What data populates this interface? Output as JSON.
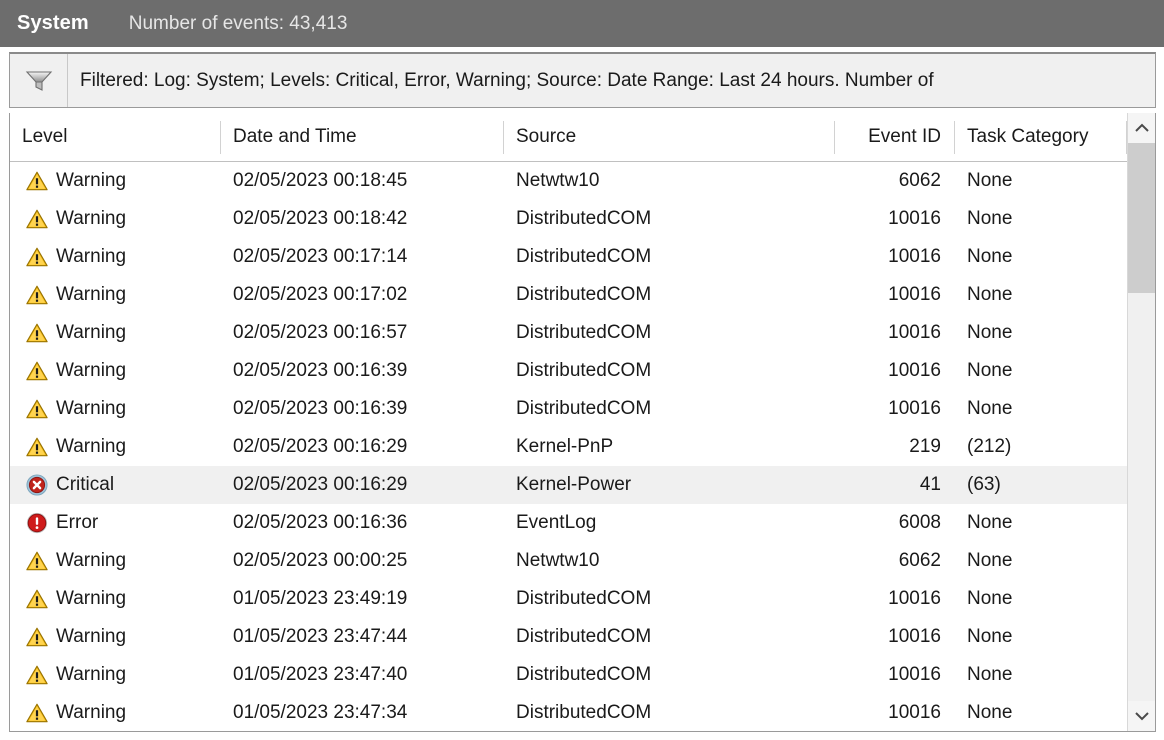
{
  "header": {
    "log_name": "System",
    "event_count_label": "Number of events: 43,413"
  },
  "filter": {
    "icon": "funnel-filter-icon",
    "text": "Filtered: Log: System; Levels: Critical, Error, Warning; Source: Date Range: Last 24 hours. Number of"
  },
  "columns": [
    {
      "key": "level",
      "label": "Level"
    },
    {
      "key": "date",
      "label": "Date and Time"
    },
    {
      "key": "source",
      "label": "Source"
    },
    {
      "key": "eventid",
      "label": "Event ID"
    },
    {
      "key": "task",
      "label": "Task Category"
    }
  ],
  "rows": [
    {
      "level": "Warning",
      "icon": "warning-icon",
      "date": "02/05/2023 00:18:45",
      "source": "Netwtw10",
      "eventid": "6062",
      "task": "None",
      "selected": false
    },
    {
      "level": "Warning",
      "icon": "warning-icon",
      "date": "02/05/2023 00:18:42",
      "source": "DistributedCOM",
      "eventid": "10016",
      "task": "None",
      "selected": false
    },
    {
      "level": "Warning",
      "icon": "warning-icon",
      "date": "02/05/2023 00:17:14",
      "source": "DistributedCOM",
      "eventid": "10016",
      "task": "None",
      "selected": false
    },
    {
      "level": "Warning",
      "icon": "warning-icon",
      "date": "02/05/2023 00:17:02",
      "source": "DistributedCOM",
      "eventid": "10016",
      "task": "None",
      "selected": false
    },
    {
      "level": "Warning",
      "icon": "warning-icon",
      "date": "02/05/2023 00:16:57",
      "source": "DistributedCOM",
      "eventid": "10016",
      "task": "None",
      "selected": false
    },
    {
      "level": "Warning",
      "icon": "warning-icon",
      "date": "02/05/2023 00:16:39",
      "source": "DistributedCOM",
      "eventid": "10016",
      "task": "None",
      "selected": false
    },
    {
      "level": "Warning",
      "icon": "warning-icon",
      "date": "02/05/2023 00:16:39",
      "source": "DistributedCOM",
      "eventid": "10016",
      "task": "None",
      "selected": false
    },
    {
      "level": "Warning",
      "icon": "warning-icon",
      "date": "02/05/2023 00:16:29",
      "source": "Kernel-PnP",
      "eventid": "219",
      "task": "(212)",
      "selected": false
    },
    {
      "level": "Critical",
      "icon": "critical-icon",
      "date": "02/05/2023 00:16:29",
      "source": "Kernel-Power",
      "eventid": "41",
      "task": "(63)",
      "selected": true
    },
    {
      "level": "Error",
      "icon": "error-icon",
      "date": "02/05/2023 00:16:36",
      "source": "EventLog",
      "eventid": "6008",
      "task": "None",
      "selected": false
    },
    {
      "level": "Warning",
      "icon": "warning-icon",
      "date": "02/05/2023 00:00:25",
      "source": "Netwtw10",
      "eventid": "6062",
      "task": "None",
      "selected": false
    },
    {
      "level": "Warning",
      "icon": "warning-icon",
      "date": "01/05/2023 23:49:19",
      "source": "DistributedCOM",
      "eventid": "10016",
      "task": "None",
      "selected": false
    },
    {
      "level": "Warning",
      "icon": "warning-icon",
      "date": "01/05/2023 23:47:44",
      "source": "DistributedCOM",
      "eventid": "10016",
      "task": "None",
      "selected": false
    },
    {
      "level": "Warning",
      "icon": "warning-icon",
      "date": "01/05/2023 23:47:40",
      "source": "DistributedCOM",
      "eventid": "10016",
      "task": "None",
      "selected": false
    },
    {
      "level": "Warning",
      "icon": "warning-icon",
      "date": "01/05/2023 23:47:34",
      "source": "DistributedCOM",
      "eventid": "10016",
      "task": "None",
      "selected": false
    }
  ],
  "scrollbar": {
    "up_icon": "chevron-up-icon",
    "down_icon": "chevron-down-icon"
  },
  "colors": {
    "title_bar": "#6d6d6d",
    "warning": "#ffc000",
    "critical": "#c0241c",
    "error": "#cf1b1b",
    "selection": "#f0f0f0"
  }
}
